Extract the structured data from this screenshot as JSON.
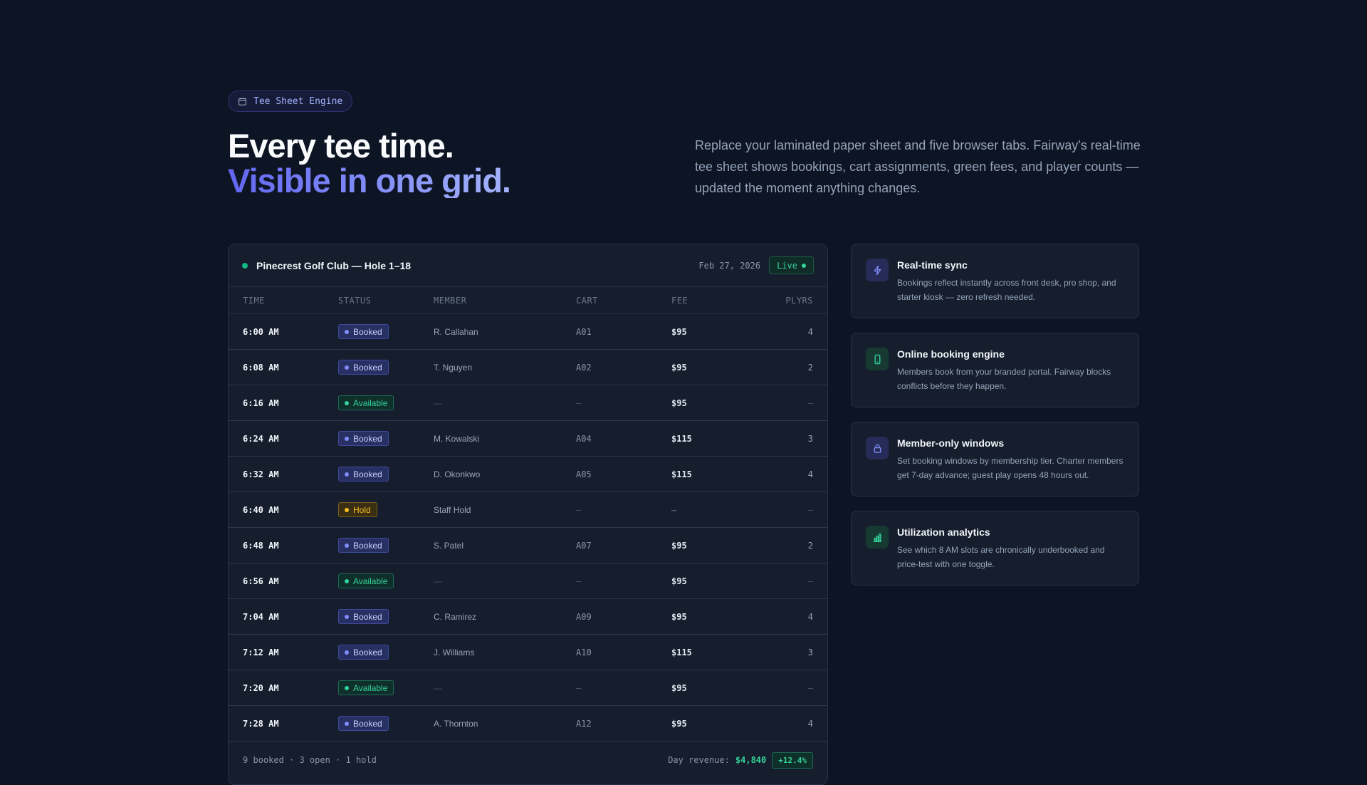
{
  "badge": {
    "label": "Tee Sheet Engine",
    "icon": "calendar-icon"
  },
  "hero": {
    "line1": "Every tee time.",
    "line2": "Visible in one grid.",
    "description": "Replace your laminated paper sheet and five browser tabs. Fairway's real-time tee sheet shows bookings, cart assignments, green fees, and player counts — updated the moment anything changes."
  },
  "sheet": {
    "club": "Pinecrest Golf Club — Hole 1–18",
    "date": "Feb 27, 2026",
    "live_label": "Live",
    "columns": [
      "TIME",
      "STATUS",
      "MEMBER",
      "CART",
      "FEE",
      "PLYRS"
    ],
    "rows": [
      {
        "time": "6:00 AM",
        "status": "Booked",
        "member": "R. Callahan",
        "cart": "A01",
        "fee": "$95",
        "players": "4"
      },
      {
        "time": "6:08 AM",
        "status": "Booked",
        "member": "T. Nguyen",
        "cart": "A02",
        "fee": "$95",
        "players": "2"
      },
      {
        "time": "6:16 AM",
        "status": "Available",
        "member": "—",
        "cart": "–",
        "fee": "$95",
        "players": "–"
      },
      {
        "time": "6:24 AM",
        "status": "Booked",
        "member": "M. Kowalski",
        "cart": "A04",
        "fee": "$115",
        "players": "3"
      },
      {
        "time": "6:32 AM",
        "status": "Booked",
        "member": "D. Okonkwo",
        "cart": "A05",
        "fee": "$115",
        "players": "4"
      },
      {
        "time": "6:40 AM",
        "status": "Hold",
        "member": "Staff Hold",
        "cart": "–",
        "fee": "–",
        "players": "–"
      },
      {
        "time": "6:48 AM",
        "status": "Booked",
        "member": "S. Patel",
        "cart": "A07",
        "fee": "$95",
        "players": "2"
      },
      {
        "time": "6:56 AM",
        "status": "Available",
        "member": "—",
        "cart": "–",
        "fee": "$95",
        "players": "–"
      },
      {
        "time": "7:04 AM",
        "status": "Booked",
        "member": "C. Ramirez",
        "cart": "A09",
        "fee": "$95",
        "players": "4"
      },
      {
        "time": "7:12 AM",
        "status": "Booked",
        "member": "J. Williams",
        "cart": "A10",
        "fee": "$115",
        "players": "3"
      },
      {
        "time": "7:20 AM",
        "status": "Available",
        "member": "—",
        "cart": "–",
        "fee": "$95",
        "players": "–"
      },
      {
        "time": "7:28 AM",
        "status": "Booked",
        "member": "A. Thornton",
        "cart": "A12",
        "fee": "$95",
        "players": "4"
      }
    ],
    "footer": {
      "summary": "9 booked · 3 open · 1 hold",
      "revenue_label": "Day revenue:",
      "revenue_value": "$4,840",
      "delta": "+12.4%"
    }
  },
  "features": [
    {
      "icon": "lightning-icon",
      "title": "Real-time sync",
      "description": "Bookings reflect instantly across front desk, pro shop, and starter kiosk — zero refresh needed."
    },
    {
      "icon": "phone-icon",
      "title": "Online booking engine",
      "description": "Members book from your branded portal. Fairway blocks conflicts before they happen."
    },
    {
      "icon": "lock-icon",
      "title": "Member-only windows",
      "description": "Set booking windows by membership tier. Charter members get 7-day advance; guest play opens 48 hours out."
    },
    {
      "icon": "bar-chart-icon",
      "title": "Utilization analytics",
      "description": "See which 8 AM slots are chronically underbooked and price-test with one toggle."
    }
  ],
  "colors": {
    "background": "#0d1424",
    "accent": "#818cf8",
    "booked": "#818cf8",
    "available": "#34d399",
    "hold": "#fbbf24"
  }
}
